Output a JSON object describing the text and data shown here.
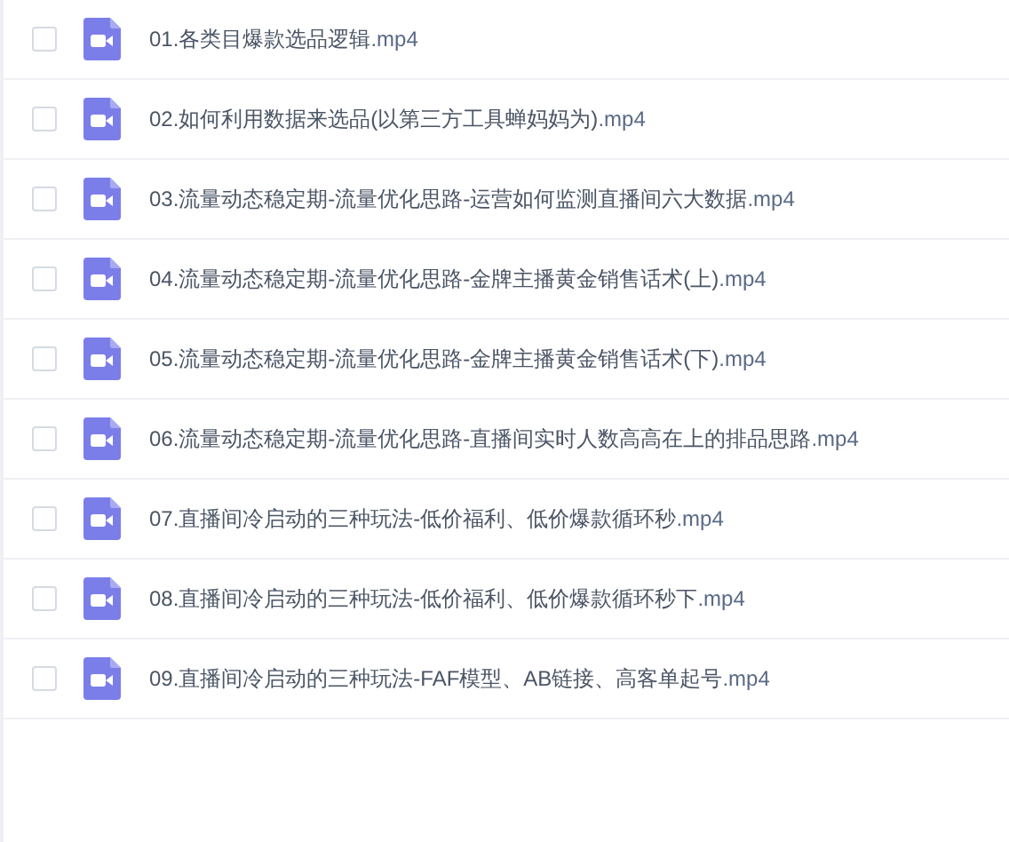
{
  "files": [
    {
      "name": "01.各类目爆款选品逻辑",
      "extension": ".mp4",
      "checked": false
    },
    {
      "name": "02.如何利用数据来选品(以第三方工具蝉妈妈为)",
      "extension": ".mp4",
      "checked": false
    },
    {
      "name": "03.流量动态稳定期-流量优化思路-运营如何监测直播间六大数据",
      "extension": ".mp4",
      "checked": false
    },
    {
      "name": "04.流量动态稳定期-流量优化思路-金牌主播黄金销售话术(上)",
      "extension": ".mp4",
      "checked": false
    },
    {
      "name": "05.流量动态稳定期-流量优化思路-金牌主播黄金销售话术(下)",
      "extension": ".mp4",
      "checked": false
    },
    {
      "name": "06.流量动态稳定期-流量优化思路-直播间实时人数高高在上的排品思路",
      "extension": ".mp4",
      "checked": false
    },
    {
      "name": "07.直播间冷启动的三种玩法-低价福利、低价爆款循环秒",
      "extension": ".mp4",
      "checked": false
    },
    {
      "name": "08.直播间冷启动的三种玩法-低价福利、低价爆款循环秒下",
      "extension": ".mp4",
      "checked": false
    },
    {
      "name": "09.直播间冷启动的三种玩法-FAF模型、AB链接、高客单起号",
      "extension": ".mp4",
      "checked": false
    }
  ]
}
